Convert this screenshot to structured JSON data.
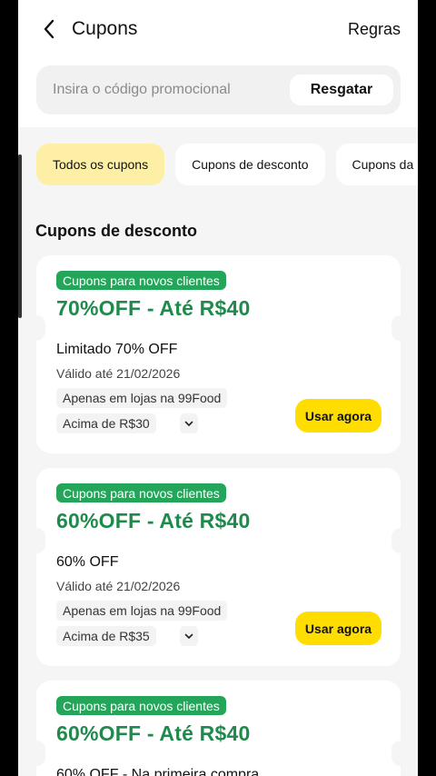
{
  "header": {
    "title": "Cupons",
    "rules_label": "Regras"
  },
  "search": {
    "placeholder": "Insira o código promocional",
    "value": "",
    "redeem_label": "Resgatar"
  },
  "tabs": [
    {
      "label": "Todos os cupons",
      "active": true
    },
    {
      "label": "Cupons de desconto",
      "active": false
    },
    {
      "label": "Cupons da",
      "active": false
    }
  ],
  "section_title": "Cupons de desconto",
  "coupons": [
    {
      "badge": "Cupons para novos clientes",
      "headline": "70%OFF - Até R$40",
      "description": "Limitado 70% OFF",
      "valid": "Válido até 21/02/2026",
      "chip_store": "Apenas em lojas na 99Food",
      "chip_min": "Acima de R$30",
      "button_label": "Usar agora"
    },
    {
      "badge": "Cupons para novos clientes",
      "headline": "60%OFF - Até R$40",
      "description": "60% OFF",
      "valid": "Válido até 21/02/2026",
      "chip_store": "Apenas em lojas na 99Food",
      "chip_min": "Acima de R$35",
      "button_label": "Usar agora"
    },
    {
      "badge": "Cupons para novos clientes",
      "headline": "60%OFF - Até R$40",
      "description": "60% OFF - Na primeira compra"
    }
  ],
  "colors": {
    "accent_yellow": "#ffdd00",
    "active_tab": "#fdf0a6",
    "badge_green": "#23a55a",
    "headline_green": "#1f8a4c"
  }
}
